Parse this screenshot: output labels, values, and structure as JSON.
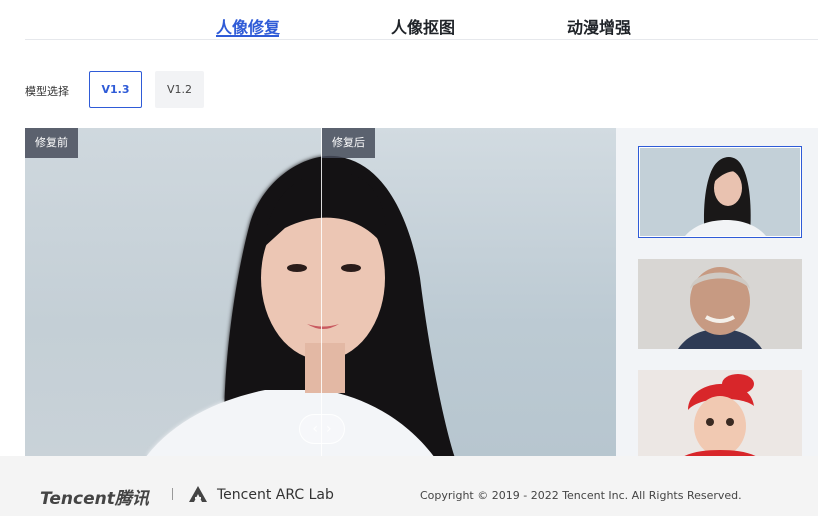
{
  "tabs": [
    {
      "label": "人像修复",
      "active": true
    },
    {
      "label": "人像抠图",
      "active": false
    },
    {
      "label": "动漫增强",
      "active": false
    }
  ],
  "model_select": {
    "label": "模型选择",
    "options": [
      {
        "label": "V1.3",
        "selected": true
      },
      {
        "label": "V1.2",
        "selected": false
      }
    ]
  },
  "compare": {
    "before_label": "修复前",
    "after_label": "修复后",
    "handle_icons": [
      "chevron-left-icon",
      "chevron-right-icon"
    ]
  },
  "thumbnails": [
    {
      "name": "young-woman",
      "selected": true
    },
    {
      "name": "older-man",
      "selected": false
    },
    {
      "name": "child-red-hat",
      "selected": false
    }
  ],
  "footer": {
    "brand": "Tencent",
    "brand_cn": "腾讯",
    "lab": "Tencent  ARC Lab",
    "copyright": "Copyright © 2019 - 2022 Tencent Inc. All Rights Reserved."
  },
  "colors": {
    "accent": "#2f5bd7",
    "footer_bg": "#f4f4f4",
    "thumb_panel_bg": "#f2f4f7"
  }
}
